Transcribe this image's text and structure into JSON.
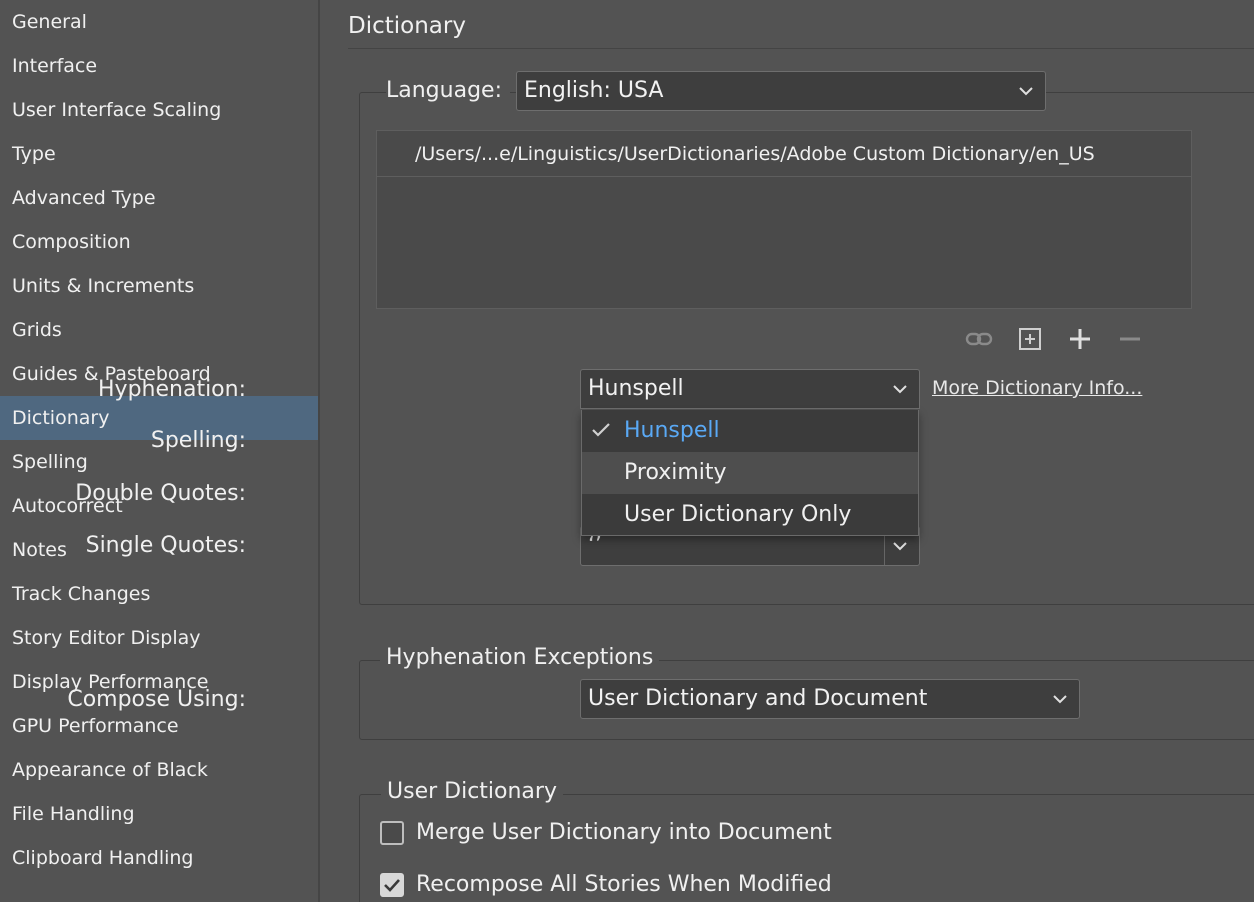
{
  "sidebar": {
    "items": [
      {
        "label": "General"
      },
      {
        "label": "Interface"
      },
      {
        "label": "User Interface Scaling"
      },
      {
        "label": "Type"
      },
      {
        "label": "Advanced Type"
      },
      {
        "label": "Composition"
      },
      {
        "label": "Units & Increments"
      },
      {
        "label": "Grids"
      },
      {
        "label": "Guides & Pasteboard"
      },
      {
        "label": "Dictionary",
        "active": true
      },
      {
        "label": "Spelling"
      },
      {
        "label": "Autocorrect"
      },
      {
        "label": "Notes"
      },
      {
        "label": "Track Changes"
      },
      {
        "label": "Story Editor Display"
      },
      {
        "label": "Display Performance"
      },
      {
        "label": "GPU Performance"
      },
      {
        "label": "Appearance of Black"
      },
      {
        "label": "File Handling"
      },
      {
        "label": "Clipboard Handling"
      }
    ]
  },
  "main": {
    "title": "Dictionary",
    "language": {
      "label": "Language:",
      "value": "English: USA"
    },
    "dictionary_list": {
      "path": "/Users/...e/Linguistics/UserDictionaries/Adobe Custom Dictionary/en_US"
    },
    "toolbar_icons": [
      "link-icon",
      "new-dictionary-icon",
      "add-icon",
      "remove-icon"
    ],
    "hyphenation": {
      "label": "Hyphenation:",
      "value": "Hunspell",
      "more_link": "More Dictionary Info...",
      "options": [
        {
          "label": "Hunspell",
          "selected": true
        },
        {
          "label": "Proximity",
          "hover": true
        },
        {
          "label": "User Dictionary Only"
        }
      ]
    },
    "spelling": {
      "label": "Spelling:"
    },
    "double_quotes": {
      "label": "Double Quotes:"
    },
    "single_quotes": {
      "label": "Single Quotes:",
      "value": "‘’"
    },
    "hyphenation_exceptions": {
      "legend": "Hyphenation Exceptions",
      "compose_label": "Compose Using:",
      "compose_value": "User Dictionary and Document"
    },
    "user_dictionary": {
      "legend": "User Dictionary",
      "merge": {
        "label": "Merge User Dictionary into Document",
        "checked": false
      },
      "recompose": {
        "label": "Recompose All Stories When Modified",
        "checked": true
      }
    }
  },
  "colors": {
    "background": "#535353",
    "active_item": "#4f6880",
    "selected_option": "#5aa9f5"
  }
}
